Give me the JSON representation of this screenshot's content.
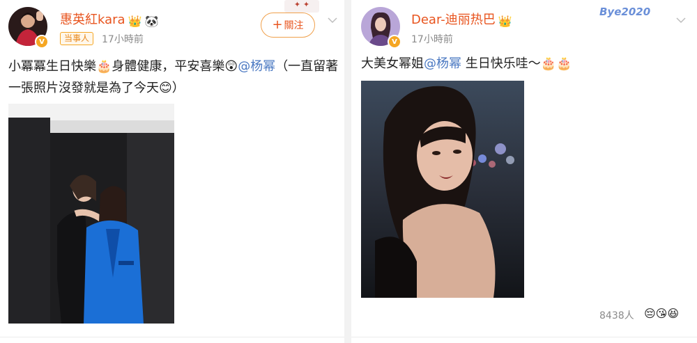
{
  "left_post": {
    "username": "惠英紅kara",
    "role_badge": "当事人",
    "timestamp": "17小時前",
    "follow_label": "關注",
    "content_part1": "小冪冪生日快樂",
    "content_part2": "身體健康，平安喜樂",
    "mention": "@杨幂",
    "content_part3": "（一直留著一張照片沒發就是為了今天",
    "content_part4": "）"
  },
  "right_post": {
    "username": "Dear-迪丽热巴",
    "timestamp": "17小時前",
    "card_deco": "Bye2020",
    "content_part1": "大美女幂姐",
    "mention": "@杨幂",
    "content_part2": " 生日快乐哇～",
    "likes_count": "8438人"
  },
  "colors": {
    "username": "#e8541e",
    "mention": "#4a78c2",
    "badge_border": "#f5a623",
    "follow_border": "#f0a04b"
  },
  "icons": {
    "crown": "crown-icon",
    "panda": "panda-icon",
    "cake": "cake-icon",
    "emoji": "face-emoji-icon",
    "chevron": "chevron-down-icon",
    "verified": "verified-badge-icon"
  }
}
